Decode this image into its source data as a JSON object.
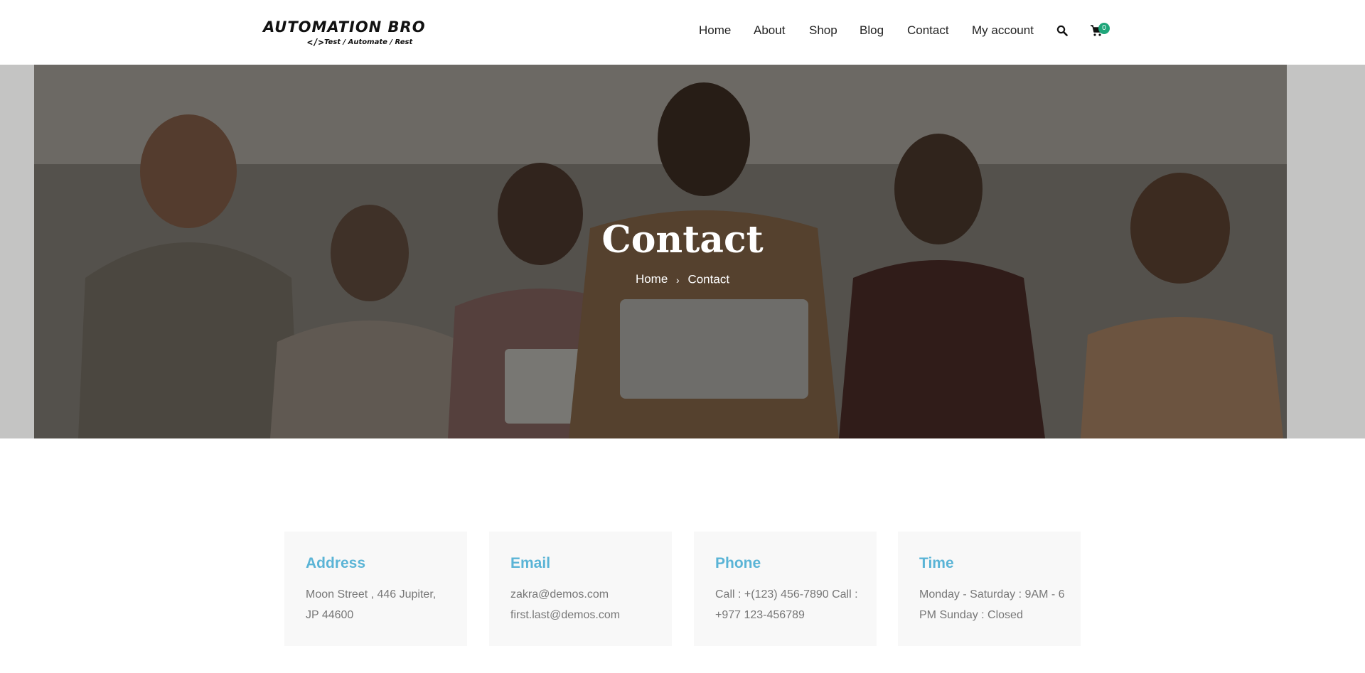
{
  "header": {
    "logo_title": "AUTOMATION BRO",
    "logo_mark": "</>",
    "logo_tagline": "Test / Automate / Rest",
    "nav": [
      "Home",
      "About",
      "Shop",
      "Blog",
      "Contact",
      "My account"
    ],
    "search_icon": "search-icon",
    "cart_icon": "shopping-cart-icon",
    "cart_count": "0"
  },
  "hero": {
    "title": "Contact",
    "breadcrumb": [
      "Home",
      "Contact"
    ],
    "breadcrumb_separator": "›"
  },
  "cards": [
    {
      "title": "Address",
      "body": "Moon Street , 446 Jupiter, JP 44600"
    },
    {
      "title": "Email",
      "body": "zakra@demos.com first.last@demos.com"
    },
    {
      "title": "Phone",
      "body": "Call : +(123) 456-7890 Call : +977 123-456789"
    },
    {
      "title": "Time",
      "body": "Monday - Saturday : 9AM - 6 PM Sunday : Closed"
    }
  ],
  "colors": {
    "accent": "#5ab4d6",
    "badge": "#1fa67a",
    "card_bg": "#f8f8f8"
  }
}
